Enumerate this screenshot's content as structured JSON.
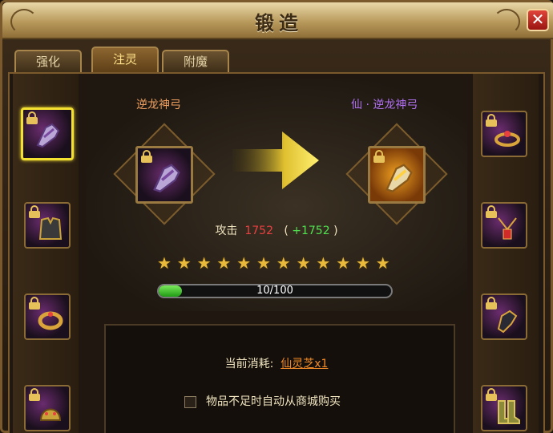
{
  "window": {
    "title": "锻造",
    "close_symbol": "✕",
    "close_color": "#c62a22",
    "accent": "#f4e030"
  },
  "tabs": [
    {
      "label": "强化",
      "active": false
    },
    {
      "label": "注灵",
      "active": true
    },
    {
      "label": "附魔",
      "active": false
    }
  ],
  "left_slots": [
    {
      "icon": "gauntlet-icon",
      "locked": true,
      "selected": true
    },
    {
      "icon": "armor-icon",
      "locked": true,
      "selected": false
    },
    {
      "icon": "ring-icon",
      "locked": true,
      "selected": false
    },
    {
      "icon": "helmet-icon",
      "locked": true,
      "selected": false
    }
  ],
  "right_slots": [
    {
      "icon": "bracelet-icon",
      "locked": true
    },
    {
      "icon": "necklace-icon",
      "locked": true
    },
    {
      "icon": "glove-icon",
      "locked": true
    },
    {
      "icon": "boots-icon",
      "locked": true
    }
  ],
  "source_item": {
    "name": "逆龙神弓",
    "name_color": "#f0a060",
    "icon": "gauntlet-icon",
    "locked": true
  },
  "target_item": {
    "name": "仙 · 逆龙神弓",
    "name_color": "#b070f0",
    "icon": "golden-gauntlet-icon",
    "locked": true
  },
  "arrow_icon": "arrow-right-icon",
  "stats": {
    "label": "攻击",
    "value": "1752",
    "value_color": "#e84040",
    "open_paren": "(",
    "bonus": "+1752",
    "bonus_color": "#50e050",
    "close_paren": ")"
  },
  "stars": {
    "count": 12,
    "icon": "star-icon",
    "color": "#e8b93a"
  },
  "progress": {
    "current": 10,
    "max": 100,
    "text": "10/100",
    "fraction": 0.1
  },
  "cost": {
    "label": "当前消耗:",
    "item": "仙灵芝x1",
    "item_color": "#f08a28"
  },
  "auto_buy": {
    "checked": false,
    "label": "物品不足时自动从商城购买"
  }
}
